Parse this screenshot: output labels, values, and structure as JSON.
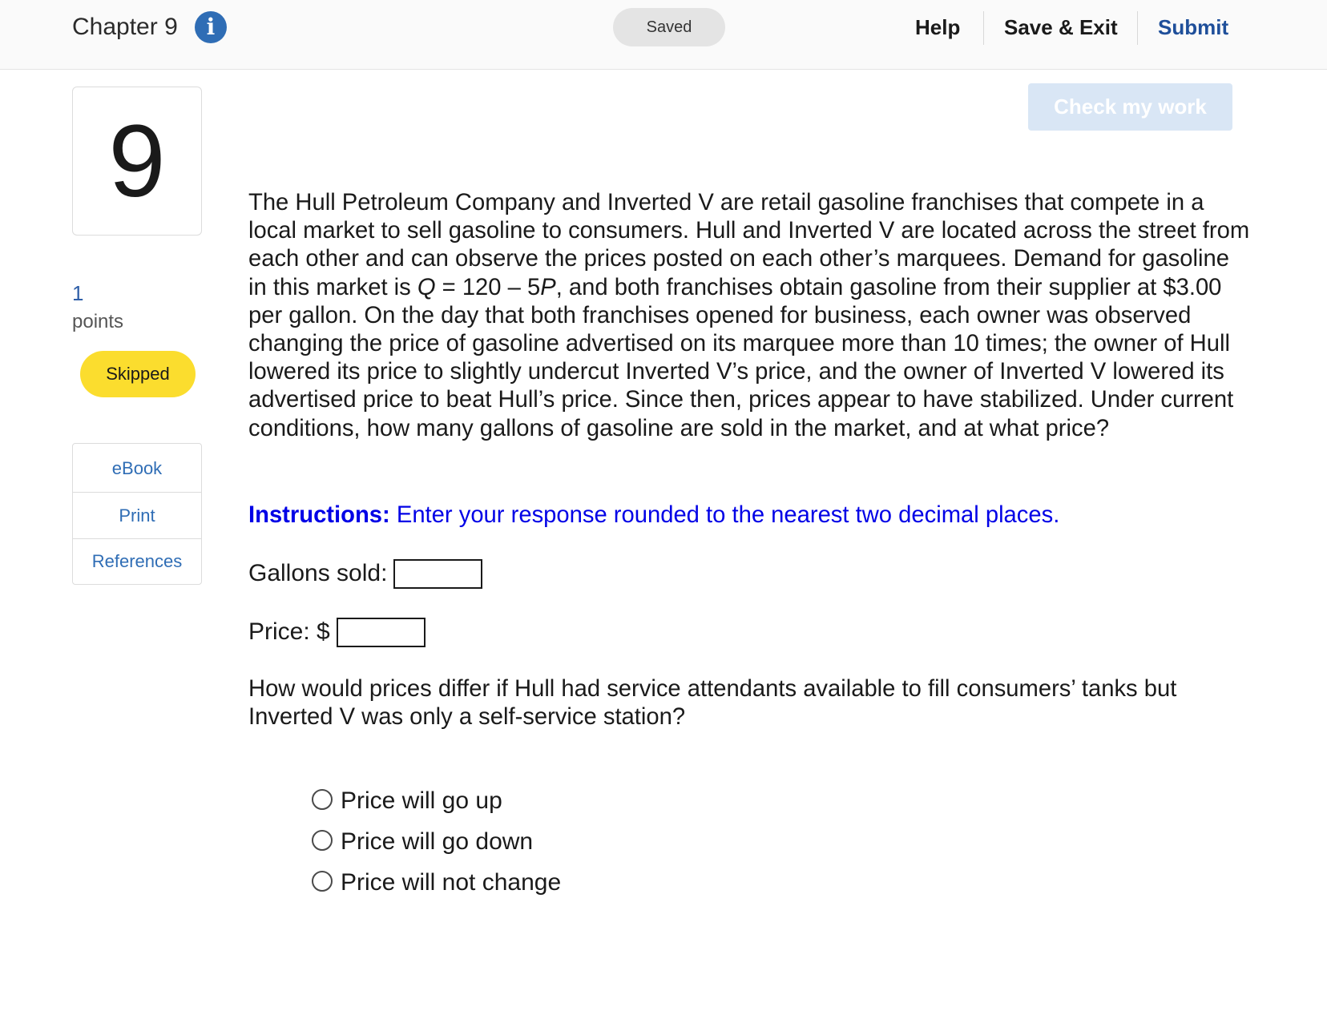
{
  "header": {
    "chapter_title": "Chapter 9",
    "info_icon": "info-icon",
    "saved_status": "Saved",
    "help_label": "Help",
    "save_exit_label": "Save & Exit",
    "submit_label": "Submit"
  },
  "sidebar": {
    "question_number": "9",
    "points_value": "1",
    "points_label": "points",
    "status_badge": "Skipped",
    "links": [
      {
        "label": "eBook"
      },
      {
        "label": "Print"
      },
      {
        "label": "References"
      }
    ]
  },
  "main": {
    "check_button_label": "Check my work",
    "question_intro": "The Hull Petroleum Company and Inverted V are retail gasoline franchises that compete in a local market to sell gasoline to consumers. Hull and Inverted V are located across the street from each other and can observe the prices posted on each other’s marquees. Demand for gasoline in this market is",
    "demand_q": "Q",
    "demand_eq": " = 120 – 5",
    "demand_p": "P",
    "question_rest": ", and both franchises obtain gasoline from their supplier at $3.00 per gallon. On the day that both franchises opened for business, each owner was observed changing the price of gasoline advertised on its marquee more than 10 times; the owner of Hull lowered its price to slightly undercut Inverted V’s price, and the owner of Inverted V lowered its advertised price to beat Hull’s price. Since then, prices appear to have stabilized. Under current conditions, how many gallons of gasoline are sold in the market, and at what price?",
    "instructions_label": "Instructions:",
    "instructions_text": " Enter your response rounded to the nearest two decimal places.",
    "gallons_label": "Gallons sold:",
    "gallons_value": "",
    "price_label": "Price: $",
    "price_value": "",
    "question_2": "How would prices differ if Hull had service attendants available to fill consumers’ tanks but Inverted V was only a self-service station?",
    "options": [
      {
        "label": "Price will go up"
      },
      {
        "label": "Price will go down"
      },
      {
        "label": "Price will not change"
      }
    ]
  },
  "colors": {
    "info_icon_bg": "#2f6db5",
    "submit_link": "#1f4f9a",
    "badge_skipped": "#fbdd2e",
    "instructions_text": "#0000e6",
    "side_link": "#2f6db5",
    "check_button_bg": "#d9e6f5"
  }
}
